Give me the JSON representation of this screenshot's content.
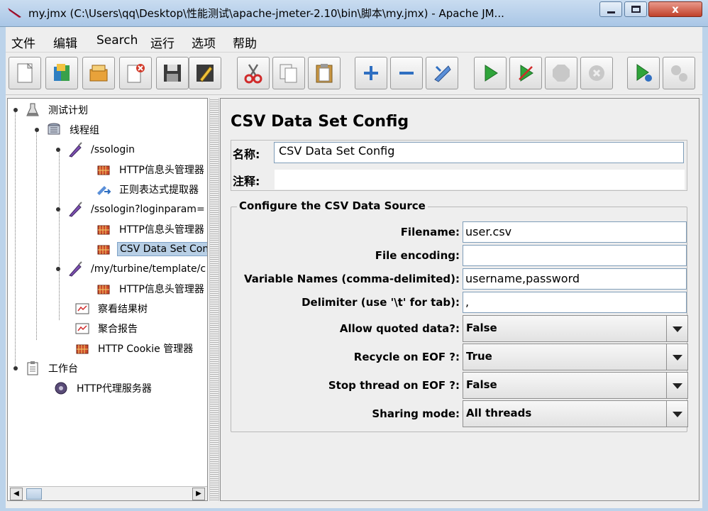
{
  "window": {
    "title": "my.jmx (C:\\Users\\qq\\Desktop\\性能测试\\apache-jmeter-2.10\\bin\\脚本\\my.jmx) - Apache JM...",
    "close_glyph": "x"
  },
  "menu": [
    "文件",
    "编辑",
    "Search",
    "运行",
    "选项",
    "帮助"
  ],
  "toolbar": [
    {
      "icon": "new-file-icon"
    },
    {
      "icon": "templates-icon"
    },
    {
      "icon": "open-icon"
    },
    {
      "icon": "close-file-icon"
    },
    {
      "icon": "save-icon"
    },
    {
      "icon": "save-as-icon"
    },
    {
      "icon": "cut-icon"
    },
    {
      "icon": "copy-icon"
    },
    {
      "icon": "paste-icon"
    },
    {
      "icon": "expand-all-icon"
    },
    {
      "icon": "collapse-all-icon"
    },
    {
      "icon": "toggle-icon"
    },
    {
      "icon": "start-icon"
    },
    {
      "icon": "start-no-timers-icon"
    },
    {
      "icon": "stop-icon"
    },
    {
      "icon": "shutdown-icon"
    },
    {
      "icon": "remote-start-icon"
    },
    {
      "icon": "remote-stop-icon"
    }
  ],
  "tree": {
    "items": [
      {
        "label": "测试计划",
        "icon": "test-plan-icon"
      },
      {
        "label": "线程组",
        "icon": "thread-group-icon"
      },
      {
        "label": "/ssologin",
        "icon": "sampler-icon"
      },
      {
        "label": "HTTP信息头管理器",
        "icon": "config-element-icon"
      },
      {
        "label": "正则表达式提取器",
        "icon": "extractor-icon"
      },
      {
        "label": "/ssologin?loginparam=",
        "icon": "sampler-icon"
      },
      {
        "label": "HTTP信息头管理器",
        "icon": "config-element-icon"
      },
      {
        "label": "CSV Data Set Config",
        "icon": "config-element-icon"
      },
      {
        "label": "/my/turbine/template/c",
        "icon": "sampler-icon"
      },
      {
        "label": "HTTP信息头管理器",
        "icon": "config-element-icon"
      },
      {
        "label": "察看结果树",
        "icon": "listener-icon"
      },
      {
        "label": "聚合报告",
        "icon": "listener-icon"
      },
      {
        "label": "HTTP Cookie 管理器",
        "icon": "config-element-icon"
      },
      {
        "label": "工作台",
        "icon": "workbench-icon"
      },
      {
        "label": "HTTP代理服务器",
        "icon": "proxy-server-icon"
      }
    ],
    "selected_index": 7
  },
  "panel": {
    "title": "CSV Data Set Config",
    "name_label": "名称:",
    "name_value": "CSV Data Set Config",
    "comment_label": "注释:",
    "comment_value": "",
    "group_title": "Configure the CSV Data Source",
    "fields": [
      {
        "label": "Filename:",
        "value": "user.csv"
      },
      {
        "label": "File encoding:",
        "value": ""
      },
      {
        "label": "Variable Names (comma-delimited):",
        "value": "username,password"
      },
      {
        "label": "Delimiter (use '\\t' for tab):",
        "value": ","
      }
    ],
    "combos": [
      {
        "label": "Allow quoted data?:",
        "value": "False"
      },
      {
        "label": "Recycle on EOF ?:",
        "value": "True"
      },
      {
        "label": "Stop thread on EOF ?:",
        "value": "False"
      },
      {
        "label": "Sharing mode:",
        "value": "All threads"
      }
    ]
  },
  "colors": {
    "selection": "#b8cfe5",
    "title_bar": "#a9c6e6",
    "close_button": "#c0412a"
  }
}
